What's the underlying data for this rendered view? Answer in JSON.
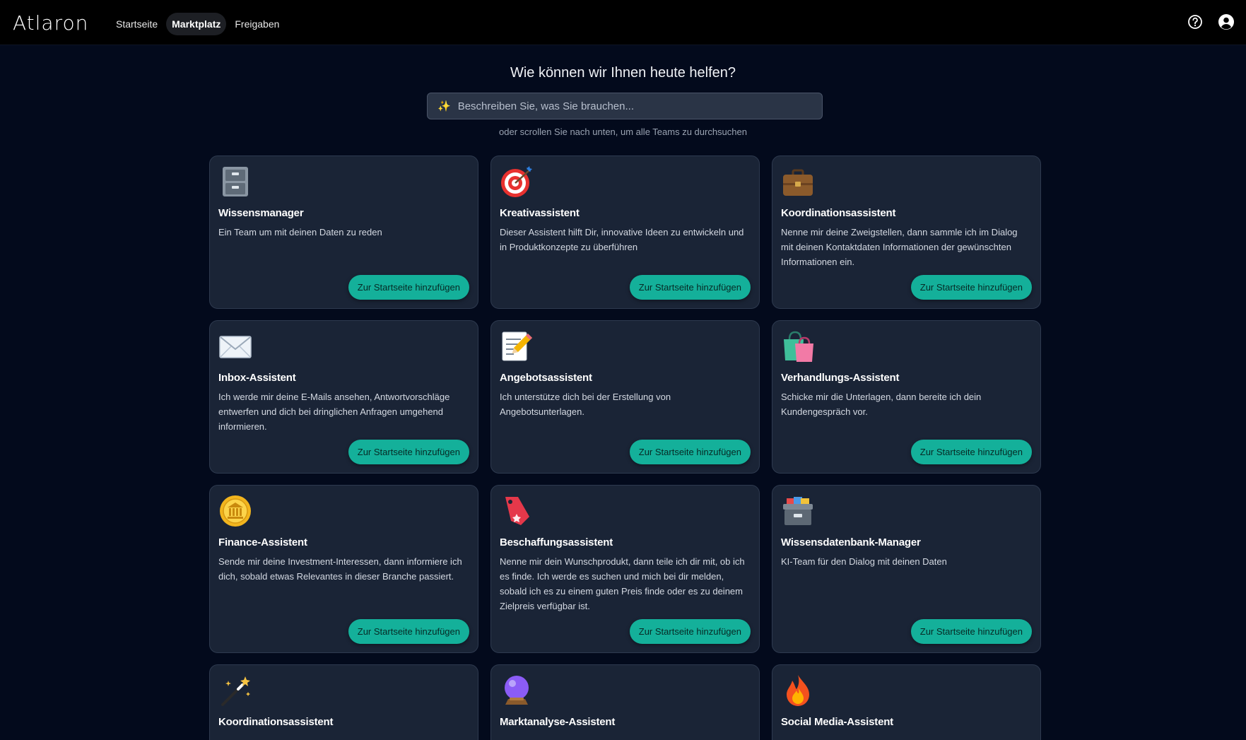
{
  "app": {
    "logo": "Atlaron"
  },
  "nav": {
    "items": [
      {
        "label": "Startseite",
        "active": false
      },
      {
        "label": "Marktplatz",
        "active": true
      },
      {
        "label": "Freigaben",
        "active": false
      }
    ]
  },
  "header_icons": [
    "help-icon",
    "user-account-icon"
  ],
  "hero": {
    "title": "Wie können wir Ihnen heute helfen?",
    "search_placeholder": "Beschreiben Sie, was Sie brauchen...",
    "search_value": "",
    "hint": "oder scrollen Sie nach unten, um alle Teams zu durchsuchen"
  },
  "colors": {
    "accent": "#14b09a",
    "background": "#030a1c",
    "card": "#1a2436"
  },
  "cards": [
    {
      "icon": "file-cabinet-icon",
      "title": "Wissensmanager",
      "description": "Ein Team um mit deinen Daten zu reden",
      "button": "Zur Startseite hinzufügen"
    },
    {
      "icon": "target-icon",
      "title": "Kreativassistent",
      "description": "Dieser Assistent hilft Dir, innovative Ideen zu entwickeln und in Produktkonzepte zu überführen",
      "button": "Zur Startseite hinzufügen"
    },
    {
      "icon": "briefcase-icon",
      "title": "Koordinationsassistent",
      "description": "Nenne mir deine Zweigstellen, dann sammle ich im Dialog mit deinen Kontaktdaten Informationen der gewünschten Informationen ein.",
      "button": "Zur Startseite hinzufügen"
    },
    {
      "icon": "envelope-icon",
      "title": "Inbox-Assistent",
      "description": "Ich werde mir deine E-Mails ansehen, Antwortvorschläge entwerfen und dich bei dringlichen Anfragen umgehend informieren.",
      "button": "Zur Startseite hinzufügen"
    },
    {
      "icon": "memo-icon",
      "title": "Angebotsassistent",
      "description": "Ich unterstütze dich bei der Erstellung von Angebotsunterlagen.",
      "button": "Zur Startseite hinzufügen"
    },
    {
      "icon": "shopping-bags-icon",
      "title": "Verhandlungs-Assistent",
      "description": "Schicke mir die Unterlagen, dann bereite ich dein Kundengespräch vor.",
      "button": "Zur Startseite hinzufügen"
    },
    {
      "icon": "coin-icon",
      "title": "Finance-Assistent",
      "description": "Sende mir deine Investment-Interessen, dann informiere ich dich, sobald etwas Relevantes in dieser Branche passiert.",
      "button": "Zur Startseite hinzufügen"
    },
    {
      "icon": "bookmark-tag-icon",
      "title": "Beschaffungsassistent",
      "description": "Nenne mir dein Wunschprodukt, dann teile ich dir mit, ob ich es finde. Ich werde es suchen und mich bei dir melden, sobald ich es zu einem guten Preis finde oder es zu deinem Zielpreis verfügbar ist.",
      "button": "Zur Startseite hinzufügen"
    },
    {
      "icon": "card-file-box-icon",
      "title": "Wissensdatenbank-Manager",
      "description": "KI-Team für den Dialog mit deinen Daten",
      "button": "Zur Startseite hinzufügen"
    },
    {
      "icon": "magic-wand-icon",
      "title": "Koordinationsassistent",
      "description": "",
      "button": ""
    },
    {
      "icon": "crystal-ball-icon",
      "title": "Marktanalyse-Assistent",
      "description": "",
      "button": ""
    },
    {
      "icon": "fire-icon",
      "title": "Social Media-Assistent",
      "description": "",
      "button": ""
    }
  ]
}
